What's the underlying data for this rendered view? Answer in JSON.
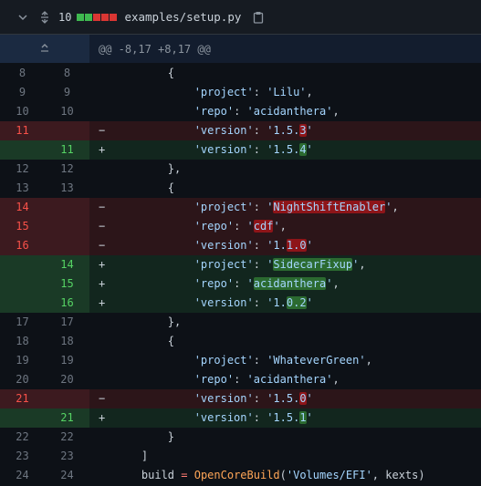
{
  "file": {
    "change_count": "10",
    "path": "examples/setup.py",
    "diffstat_colors": [
      "#3fb950",
      "#3fb950",
      "#da3633",
      "#da3633",
      "#da3633"
    ]
  },
  "hunk": {
    "header": "@@ -8,17 +8,17 @@"
  },
  "lines": [
    {
      "type": "ctx",
      "old": "8",
      "new": "8",
      "segs": [
        {
          "t": "        {"
        }
      ]
    },
    {
      "type": "ctx",
      "old": "9",
      "new": "9",
      "segs": [
        {
          "t": "            "
        },
        {
          "t": "'project'",
          "c": "str"
        },
        {
          "t": ": "
        },
        {
          "t": "'Lilu'",
          "c": "str"
        },
        {
          "t": ","
        }
      ]
    },
    {
      "type": "ctx",
      "old": "10",
      "new": "10",
      "segs": [
        {
          "t": "            "
        },
        {
          "t": "'repo'",
          "c": "str"
        },
        {
          "t": ": "
        },
        {
          "t": "'acidanthera'",
          "c": "str"
        },
        {
          "t": ","
        }
      ]
    },
    {
      "type": "del",
      "old": "11",
      "new": "",
      "segs": [
        {
          "t": "            "
        },
        {
          "t": "'version'",
          "c": "str"
        },
        {
          "t": ": "
        },
        {
          "t": "'1.5.",
          "c": "str"
        },
        {
          "t": "3",
          "c": "str",
          "h": 1
        },
        {
          "t": "'",
          "c": "str"
        }
      ]
    },
    {
      "type": "add",
      "old": "",
      "new": "11",
      "segs": [
        {
          "t": "            "
        },
        {
          "t": "'version'",
          "c": "str"
        },
        {
          "t": ": "
        },
        {
          "t": "'1.5.",
          "c": "str"
        },
        {
          "t": "4",
          "c": "str",
          "h": 1
        },
        {
          "t": "'",
          "c": "str"
        }
      ]
    },
    {
      "type": "ctx",
      "old": "12",
      "new": "12",
      "segs": [
        {
          "t": "        },"
        }
      ]
    },
    {
      "type": "ctx",
      "old": "13",
      "new": "13",
      "segs": [
        {
          "t": "        {"
        }
      ]
    },
    {
      "type": "del",
      "old": "14",
      "new": "",
      "segs": [
        {
          "t": "            "
        },
        {
          "t": "'project'",
          "c": "str"
        },
        {
          "t": ": "
        },
        {
          "t": "'",
          "c": "str"
        },
        {
          "t": "NightShiftEnabler",
          "c": "str",
          "h": 1
        },
        {
          "t": "'",
          "c": "str"
        },
        {
          "t": ","
        }
      ]
    },
    {
      "type": "del",
      "old": "15",
      "new": "",
      "segs": [
        {
          "t": "            "
        },
        {
          "t": "'repo'",
          "c": "str"
        },
        {
          "t": ": "
        },
        {
          "t": "'",
          "c": "str"
        },
        {
          "t": "cdf",
          "c": "str",
          "h": 1
        },
        {
          "t": "'",
          "c": "str"
        },
        {
          "t": ","
        }
      ]
    },
    {
      "type": "del",
      "old": "16",
      "new": "",
      "segs": [
        {
          "t": "            "
        },
        {
          "t": "'version'",
          "c": "str"
        },
        {
          "t": ": "
        },
        {
          "t": "'1.",
          "c": "str"
        },
        {
          "t": "1.0",
          "c": "str",
          "h": 1
        },
        {
          "t": "'",
          "c": "str"
        }
      ]
    },
    {
      "type": "add",
      "old": "",
      "new": "14",
      "segs": [
        {
          "t": "            "
        },
        {
          "t": "'project'",
          "c": "str"
        },
        {
          "t": ": "
        },
        {
          "t": "'",
          "c": "str"
        },
        {
          "t": "SidecarFixup",
          "c": "str",
          "h": 1
        },
        {
          "t": "'",
          "c": "str"
        },
        {
          "t": ","
        }
      ]
    },
    {
      "type": "add",
      "old": "",
      "new": "15",
      "segs": [
        {
          "t": "            "
        },
        {
          "t": "'repo'",
          "c": "str"
        },
        {
          "t": ": "
        },
        {
          "t": "'",
          "c": "str"
        },
        {
          "t": "acidanthera",
          "c": "str",
          "h": 1
        },
        {
          "t": "'",
          "c": "str"
        },
        {
          "t": ","
        }
      ]
    },
    {
      "type": "add",
      "old": "",
      "new": "16",
      "segs": [
        {
          "t": "            "
        },
        {
          "t": "'version'",
          "c": "str"
        },
        {
          "t": ": "
        },
        {
          "t": "'1.",
          "c": "str"
        },
        {
          "t": "0.2",
          "c": "str",
          "h": 1
        },
        {
          "t": "'",
          "c": "str"
        }
      ]
    },
    {
      "type": "ctx",
      "old": "17",
      "new": "17",
      "segs": [
        {
          "t": "        },"
        }
      ]
    },
    {
      "type": "ctx",
      "old": "18",
      "new": "18",
      "segs": [
        {
          "t": "        {"
        }
      ]
    },
    {
      "type": "ctx",
      "old": "19",
      "new": "19",
      "segs": [
        {
          "t": "            "
        },
        {
          "t": "'project'",
          "c": "str"
        },
        {
          "t": ": "
        },
        {
          "t": "'WhateverGreen'",
          "c": "str"
        },
        {
          "t": ","
        }
      ]
    },
    {
      "type": "ctx",
      "old": "20",
      "new": "20",
      "segs": [
        {
          "t": "            "
        },
        {
          "t": "'repo'",
          "c": "str"
        },
        {
          "t": ": "
        },
        {
          "t": "'acidanthera'",
          "c": "str"
        },
        {
          "t": ","
        }
      ]
    },
    {
      "type": "del",
      "old": "21",
      "new": "",
      "segs": [
        {
          "t": "            "
        },
        {
          "t": "'version'",
          "c": "str"
        },
        {
          "t": ": "
        },
        {
          "t": "'1.5.",
          "c": "str"
        },
        {
          "t": "0",
          "c": "str",
          "h": 1
        },
        {
          "t": "'",
          "c": "str"
        }
      ]
    },
    {
      "type": "add",
      "old": "",
      "new": "21",
      "segs": [
        {
          "t": "            "
        },
        {
          "t": "'version'",
          "c": "str"
        },
        {
          "t": ": "
        },
        {
          "t": "'1.5.",
          "c": "str"
        },
        {
          "t": "1",
          "c": "str",
          "h": 1
        },
        {
          "t": "'",
          "c": "str"
        }
      ]
    },
    {
      "type": "ctx",
      "old": "22",
      "new": "22",
      "segs": [
        {
          "t": "        }"
        }
      ]
    },
    {
      "type": "ctx",
      "old": "23",
      "new": "23",
      "segs": [
        {
          "t": "    ]"
        }
      ]
    },
    {
      "type": "ctx",
      "old": "24",
      "new": "24",
      "segs": [
        {
          "t": "    build "
        },
        {
          "t": "=",
          "c": "op"
        },
        {
          "t": " "
        },
        {
          "t": "OpenCoreBuild",
          "c": "fn"
        },
        {
          "t": "("
        },
        {
          "t": "'Volumes/EFI'",
          "c": "str"
        },
        {
          "t": ", kexts)"
        }
      ]
    }
  ]
}
